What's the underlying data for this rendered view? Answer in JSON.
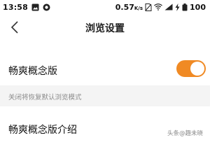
{
  "status_bar": {
    "time": "13:58",
    "speed_value": "0.57",
    "speed_unit": "K/s",
    "battery": "100",
    "icons": [
      "image-icon",
      "app-notification-icon",
      "no-sim-icon",
      "wifi-icon",
      "signal-icon",
      "charging-icon"
    ]
  },
  "header": {
    "back_icon": "chevron-left-icon",
    "title": "浏览设置"
  },
  "settings": {
    "smooth_mode_label": "畅爽概念版",
    "smooth_mode_enabled": true,
    "smooth_mode_hint": "关闭将恢复默认浏览模式",
    "intro_label": "畅爽概念版介绍"
  },
  "watermark": "头条@趣未晓",
  "colors": {
    "toggle_on": "#f08a24",
    "hint_background": "#f4f4f4",
    "hint_text": "#8c8c8c"
  }
}
